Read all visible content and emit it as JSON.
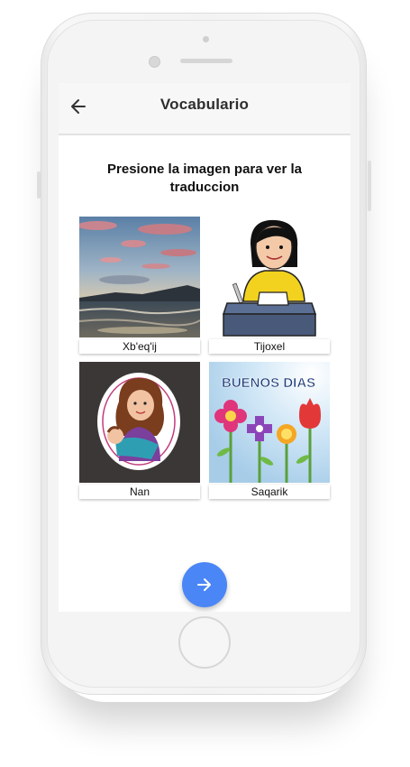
{
  "appbar": {
    "title": "Vocabulario",
    "back_icon": "arrow-left-icon"
  },
  "prompt": "Presione la imagen para ver la traduccion",
  "cards": [
    {
      "label": "Xb'eq'ij",
      "image": "sunset-beach-photo"
    },
    {
      "label": "Tijoxel",
      "image": "student-at-desk-illustration"
    },
    {
      "label": "Nan",
      "image": "mother-with-baby-illustration"
    },
    {
      "label": "Saqarik",
      "image": "buenos-dias-flowers-illustration",
      "image_text": "BUENOS DIAS"
    }
  ],
  "fab": {
    "icon": "arrow-right-icon"
  },
  "colors": {
    "accent": "#4a86f6",
    "appbar_bg": "#f7f7f7",
    "screen_bg": "#ffffff"
  }
}
